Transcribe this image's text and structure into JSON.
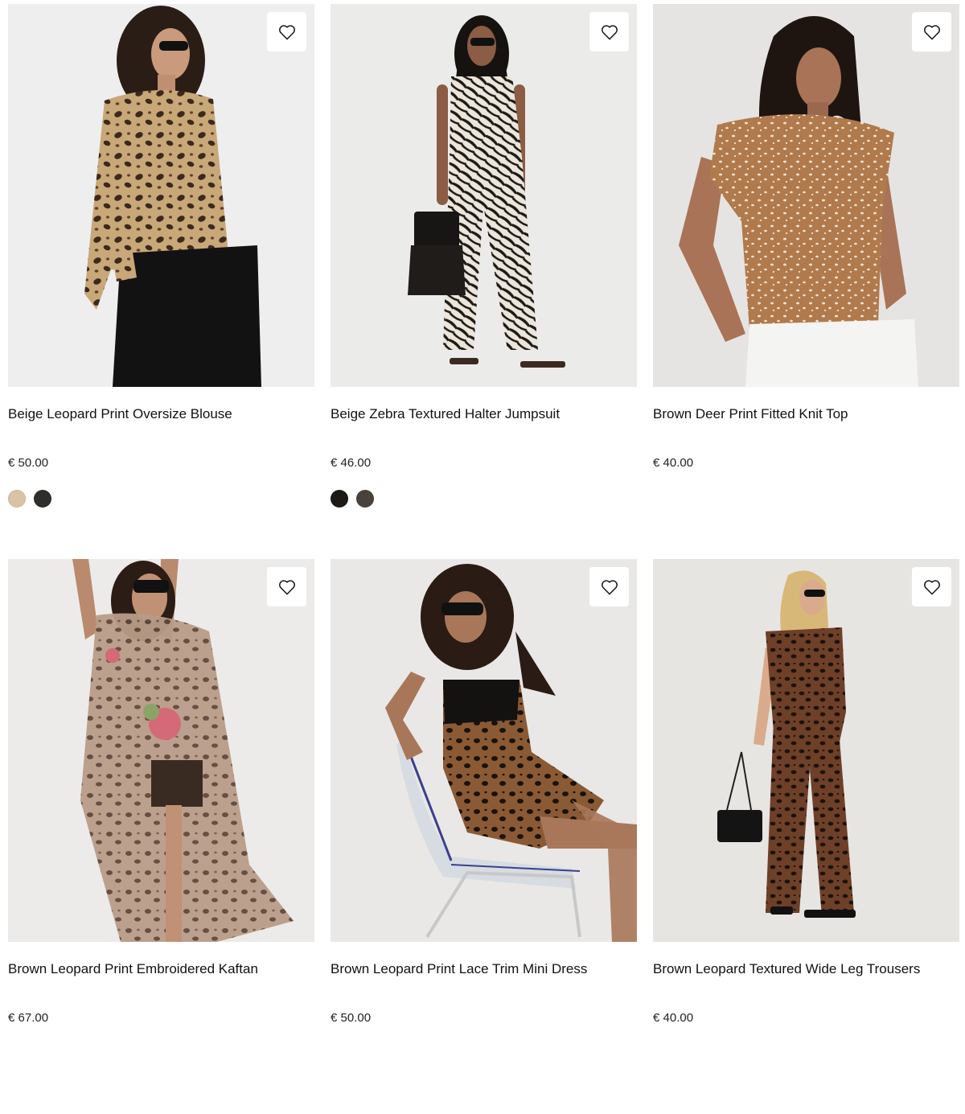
{
  "products": [
    {
      "title": "Beige Leopard Print Oversize Blouse",
      "price": "€ 50.00",
      "image": "model in leopard print oversize blouse and black shorts",
      "swatches": [
        "#d8c4a4",
        "#2e2f2a"
      ]
    },
    {
      "title": "Beige Zebra Textured Halter Jumpsuit",
      "price": "€ 46.00",
      "image": "model in zebra print halter jumpsuit with fringed bag",
      "swatches": [
        "#1c1916",
        "#4a413a"
      ]
    },
    {
      "title": "Brown Deer Print Fitted Knit Top",
      "price": "€ 40.00",
      "image": "model in brown dotted knit top and white jeans",
      "swatches": []
    },
    {
      "title": "Brown Leopard Print Embroidered Kaftan",
      "price": "€ 67.00",
      "image": "model in sheer leopard print floral kaftan",
      "swatches": []
    },
    {
      "title": "Brown Leopard Print Lace Trim Mini Dress",
      "price": "€ 50.00",
      "image": "model seated on clear chair in leopard lace trim mini dress",
      "swatches": []
    },
    {
      "title": "Brown Leopard Textured Wide Leg Trousers",
      "price": "€ 40.00",
      "image": "model in leopard print top and wide leg trousers with black bag",
      "swatches": []
    }
  ],
  "icons": {
    "wishlist": "heart-outline-icon"
  },
  "colors": {
    "text": "#111111",
    "price": "#222222",
    "image_background": "#ececec"
  }
}
